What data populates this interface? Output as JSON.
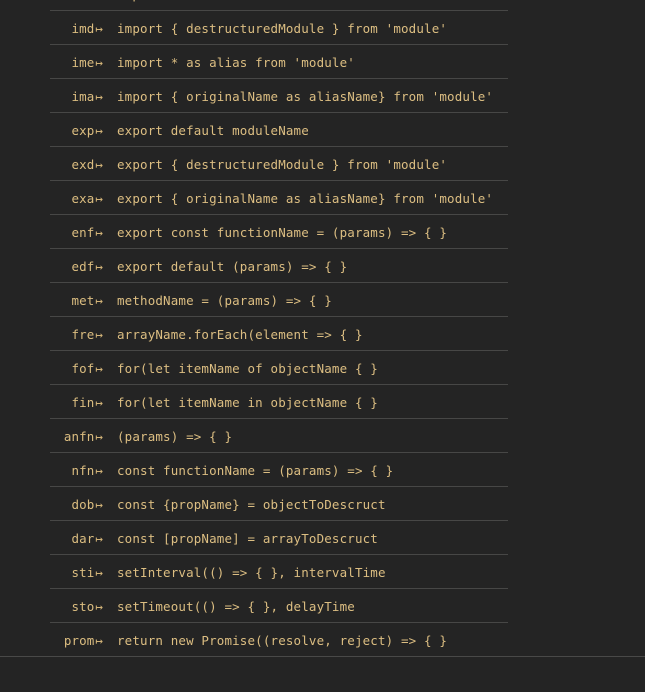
{
  "panel": {
    "name": "snippet-suggestion-list",
    "background_color": "#242424",
    "text_color": "#dcbe82",
    "divider_color": "#474746",
    "trigger_arrow_glyph": "↦"
  },
  "rows": [
    {
      "trigger": "imn",
      "arrow": "↦",
      "body": "import 'module'"
    },
    {
      "trigger": "imd",
      "arrow": "↦",
      "body": "import { destructuredModule } from 'module'"
    },
    {
      "trigger": "ime",
      "arrow": "↦",
      "body": "import * as alias from 'module'"
    },
    {
      "trigger": "ima",
      "arrow": "↦",
      "body": "import { originalName as aliasName} from 'module'"
    },
    {
      "trigger": "exp",
      "arrow": "↦",
      "body": "export default moduleName"
    },
    {
      "trigger": "exd",
      "arrow": "↦",
      "body": "export { destructuredModule } from 'module'"
    },
    {
      "trigger": "exa",
      "arrow": "↦",
      "body": "export { originalName as aliasName} from 'module'"
    },
    {
      "trigger": "enf",
      "arrow": "↦",
      "body": "export const functionName = (params) => { }"
    },
    {
      "trigger": "edf",
      "arrow": "↦",
      "body": "export default (params) => { }"
    },
    {
      "trigger": "met",
      "arrow": "↦",
      "body": "methodName = (params) => { }"
    },
    {
      "trigger": "fre",
      "arrow": "↦",
      "body": "arrayName.forEach(element => { }"
    },
    {
      "trigger": "fof",
      "arrow": "↦",
      "body": "for(let itemName of objectName { }"
    },
    {
      "trigger": "fin",
      "arrow": "↦",
      "body": "for(let itemName in objectName { }"
    },
    {
      "trigger": "anfn",
      "arrow": "↦",
      "body": "(params) => { }"
    },
    {
      "trigger": "nfn",
      "arrow": "↦",
      "body": "const functionName = (params) => { }"
    },
    {
      "trigger": "dob",
      "arrow": "↦",
      "body": "const {propName} = objectToDescruct"
    },
    {
      "trigger": "dar",
      "arrow": "↦",
      "body": "const [propName] = arrayToDescruct"
    },
    {
      "trigger": "sti",
      "arrow": "↦",
      "body": "setInterval(() => { }, intervalTime"
    },
    {
      "trigger": "sto",
      "arrow": "↦",
      "body": "setTimeout(() => { }, delayTime"
    },
    {
      "trigger": "prom",
      "arrow": "↦",
      "body": "return new Promise((resolve, reject) => { }"
    }
  ]
}
